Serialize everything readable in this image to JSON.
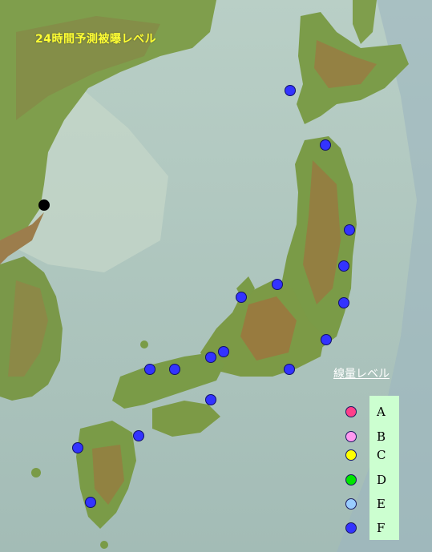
{
  "title": "24時間予測被曝レベル",
  "legend": {
    "heading": "線量レベル",
    "levels": [
      {
        "label": "A",
        "color": "#ff3f8a"
      },
      {
        "label": "B",
        "color": "#ff99f0"
      },
      {
        "label": "C",
        "color": "#ffff00"
      },
      {
        "label": "D",
        "color": "#00e600"
      },
      {
        "label": "E",
        "color": "#99ccff"
      },
      {
        "label": "F",
        "color": "#3333ff"
      }
    ]
  },
  "stations": [
    {
      "level": "F"
    },
    {
      "level": "F"
    },
    {
      "level": "F"
    },
    {
      "level": "F"
    },
    {
      "level": "F"
    },
    {
      "level": "F"
    },
    {
      "level": "F"
    },
    {
      "level": "F"
    },
    {
      "level": "F"
    },
    {
      "level": "F"
    },
    {
      "level": "F"
    },
    {
      "level": "F"
    },
    {
      "level": "F"
    },
    {
      "level": "F"
    },
    {
      "level": "F"
    },
    {
      "level": "F"
    },
    {
      "level": "F"
    },
    {
      "level": "F"
    }
  ],
  "reference_point": {
    "color": "#000000"
  }
}
